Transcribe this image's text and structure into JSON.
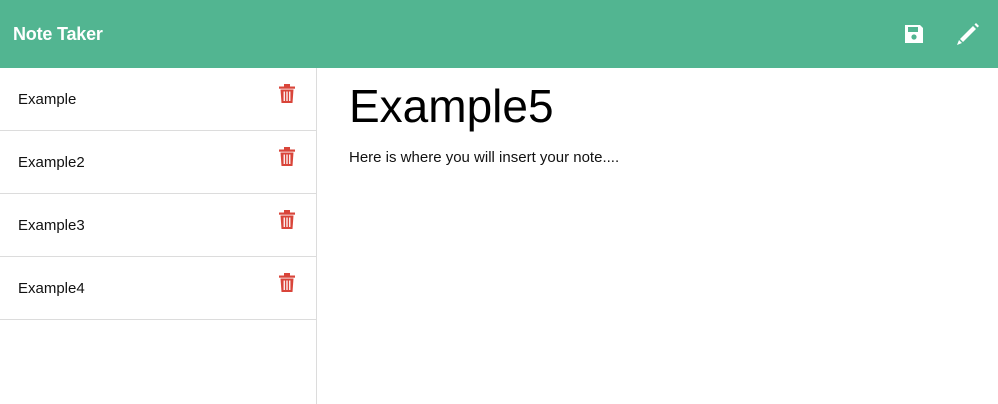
{
  "navbar": {
    "brand": "Note Taker",
    "save_icon": "floppy-disk-icon",
    "new_note_icon": "pencil-icon",
    "background_color": "#52b591"
  },
  "sidebar": {
    "notes": [
      {
        "title": "Example",
        "delete_icon": "trash-icon"
      },
      {
        "title": "Example2",
        "delete_icon": "trash-icon"
      },
      {
        "title": "Example3",
        "delete_icon": "trash-icon"
      },
      {
        "title": "Example4",
        "delete_icon": "trash-icon"
      }
    ],
    "delete_icon_color": "#d9453a"
  },
  "editor": {
    "title_value": "Example5",
    "body_value": "Here is where you will insert your note...."
  }
}
